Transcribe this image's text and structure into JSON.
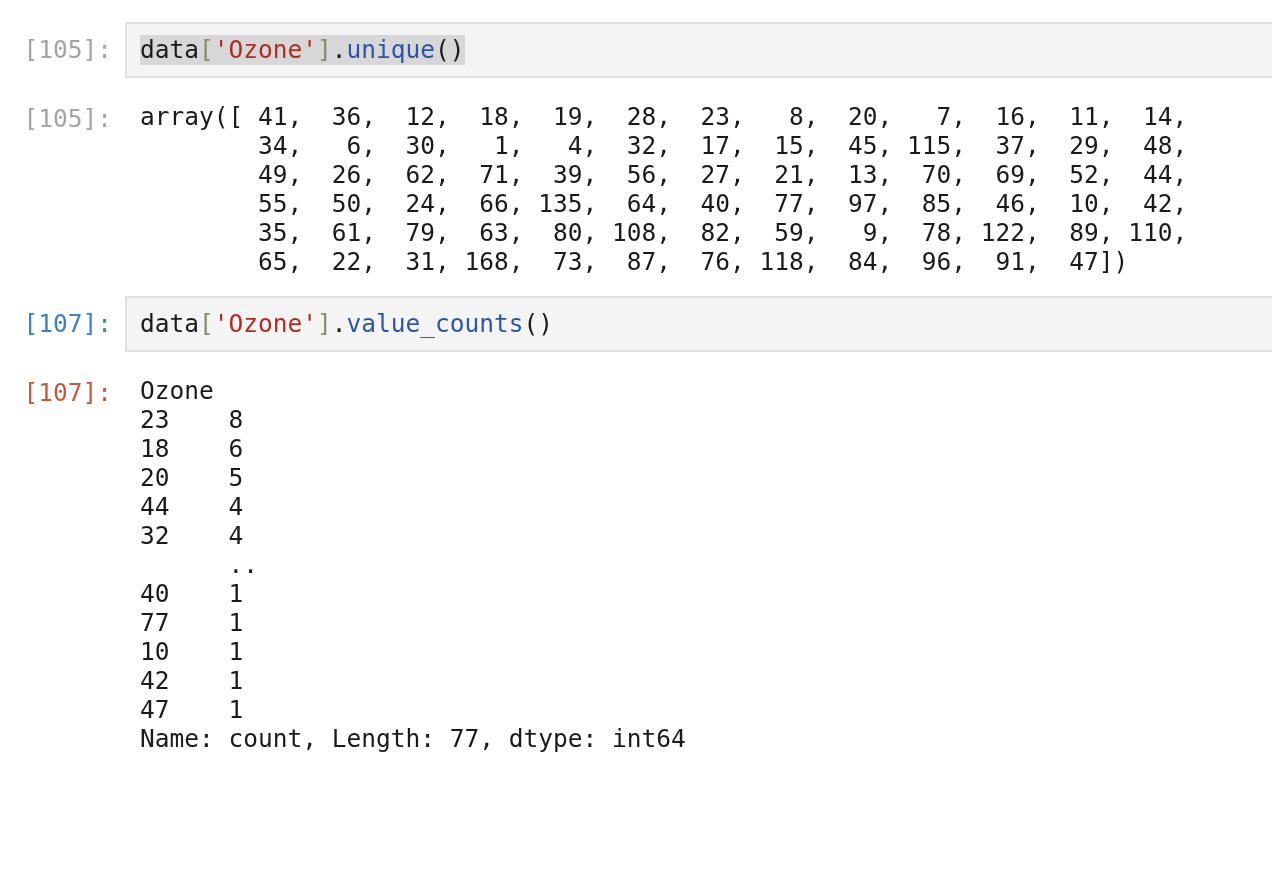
{
  "cells": [
    {
      "prompt": "[105]:",
      "selected": false,
      "highlighted": true,
      "code": [
        {
          "text": "data",
          "kind": "name"
        },
        {
          "text": "[",
          "kind": "bracket"
        },
        {
          "text": "'Ozone'",
          "kind": "string"
        },
        {
          "text": "]",
          "kind": "bracket"
        },
        {
          "text": ".",
          "kind": "punct"
        },
        {
          "text": "unique",
          "kind": "method"
        },
        {
          "text": "()",
          "kind": "punct"
        }
      ],
      "output_prompt": "[105]:",
      "output": [
        "array([ 41,  36,  12,  18,  19,  28,  23,   8,  20,   7,  16,  11,  14,",
        "        34,   6,  30,   1,   4,  32,  17,  15,  45, 115,  37,  29,  48,",
        "        49,  26,  62,  71,  39,  56,  27,  21,  13,  70,  69,  52,  44,",
        "        55,  50,  24,  66, 135,  64,  40,  77,  97,  85,  46,  10,  42,",
        "        35,  61,  79,  63,  80, 108,  82,  59,   9,  78, 122,  89, 110,",
        "        65,  22,  31, 168,  73,  87,  76, 118,  84,  96,  91,  47])"
      ]
    },
    {
      "prompt": "[107]:",
      "selected": true,
      "highlighted": false,
      "code": [
        {
          "text": "data",
          "kind": "name"
        },
        {
          "text": "[",
          "kind": "bracket"
        },
        {
          "text": "'Ozone'",
          "kind": "string"
        },
        {
          "text": "]",
          "kind": "bracket"
        },
        {
          "text": ".",
          "kind": "punct"
        },
        {
          "text": "value_counts",
          "kind": "method"
        },
        {
          "text": "()",
          "kind": "punct"
        }
      ],
      "output_prompt": "[107]:",
      "output": [
        "Ozone",
        "23    8",
        "18    6",
        "20    5",
        "44    4",
        "32    4",
        "      ..",
        "40    1",
        "77    1",
        "10    1",
        "42    1",
        "47    1",
        "Name: count, Length: 77, dtype: int64"
      ]
    }
  ]
}
